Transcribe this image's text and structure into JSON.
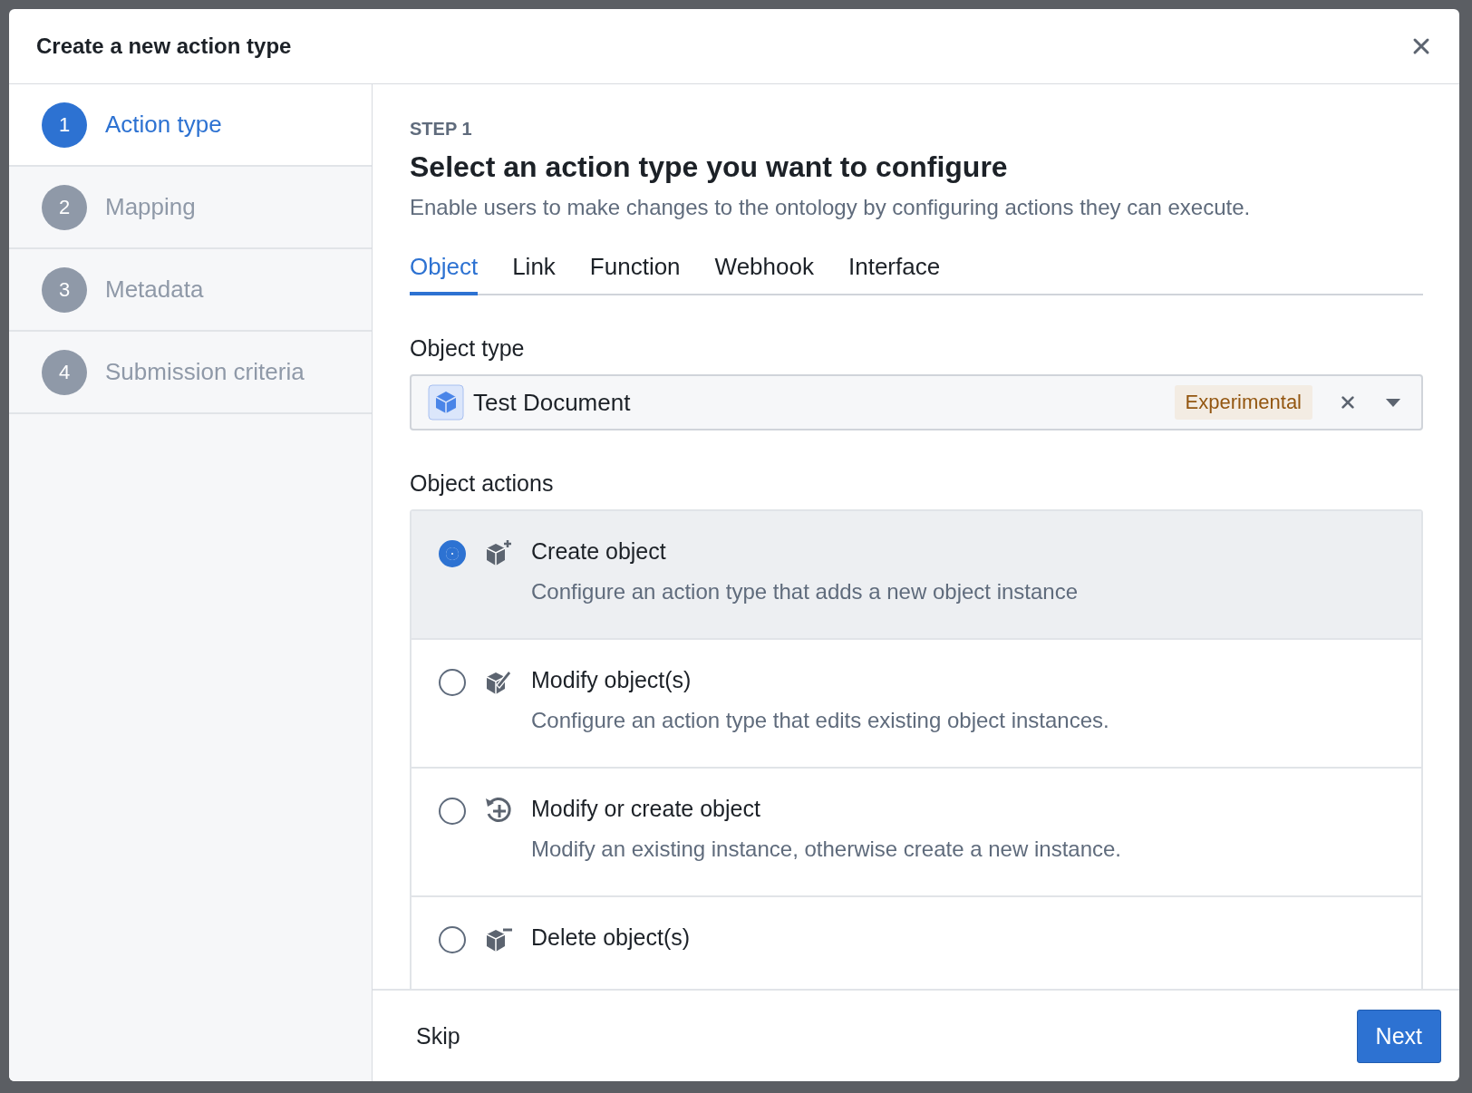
{
  "dialog": {
    "title": "Create a new action type"
  },
  "steps": [
    {
      "number": "1",
      "label": "Action type",
      "selected": true
    },
    {
      "number": "2",
      "label": "Mapping",
      "selected": false
    },
    {
      "number": "3",
      "label": "Metadata",
      "selected": false
    },
    {
      "number": "4",
      "label": "Submission criteria",
      "selected": false
    }
  ],
  "step_label": "STEP 1",
  "heading": "Select an action type you want to configure",
  "subheading": "Enable users to make changes to the ontology by configuring actions they can execute.",
  "tabs": [
    {
      "label": "Object",
      "selected": true
    },
    {
      "label": "Link",
      "selected": false
    },
    {
      "label": "Function",
      "selected": false
    },
    {
      "label": "Webhook",
      "selected": false
    },
    {
      "label": "Interface",
      "selected": false
    }
  ],
  "object_type": {
    "label": "Object type",
    "value": "Test Document",
    "tag": "Experimental"
  },
  "object_actions": {
    "label": "Object actions",
    "items": [
      {
        "kind": "create",
        "title": "Create object",
        "description": "Configure an action type that adds a new object instance",
        "selected": true
      },
      {
        "kind": "modify",
        "title": "Modify object(s)",
        "description": "Configure an action type that edits existing object instances.",
        "selected": false
      },
      {
        "kind": "upsert",
        "title": "Modify or create object",
        "description": "Modify an existing instance, otherwise create a new instance.",
        "selected": false
      },
      {
        "kind": "delete",
        "title": "Delete object(s)",
        "selected": false
      }
    ]
  },
  "footer": {
    "skip": "Skip",
    "next": "Next"
  }
}
